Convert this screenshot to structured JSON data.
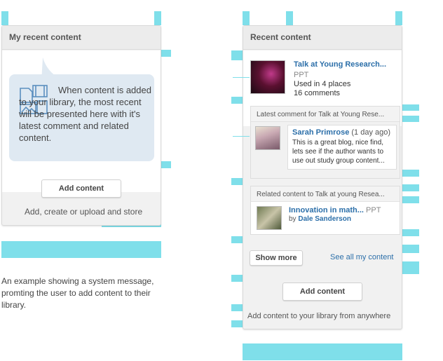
{
  "left_panel": {
    "title": "My recent content",
    "message": "When content is added to your library, the most recent will be presented here with it's latest comment and related content.",
    "add_button": "Add content",
    "footer_text": "Add, create or upload and store"
  },
  "caption": "An example showing a system message, promting the user to add content to their library.",
  "right_panel": {
    "title": "Recent content",
    "item": {
      "title": "Talk at Young Research...",
      "type": "PPT",
      "used": "Used in 4 places",
      "comments": "16 comments"
    },
    "latest_comment": {
      "header": "Latest comment for Talk at Young Rese...",
      "author": "Sarah Primrose",
      "time": "(1 day ago)",
      "text": "This is a great blog, nice find, lets see if the author wants to use out study group content..."
    },
    "related": {
      "header": "Related content to Talk at young Resea...",
      "title": "Innovation in math...",
      "type": "PPT",
      "by_label": "by",
      "author": "Dale Sanderson"
    },
    "show_more": "Show more",
    "see_all": "See all my content",
    "add_button": "Add content",
    "footer_text": "Add content to your library from anywhere"
  },
  "colors": {
    "guide": "#7fdfea",
    "link": "#2c6fa9",
    "bubble": "#dfe9f2"
  }
}
